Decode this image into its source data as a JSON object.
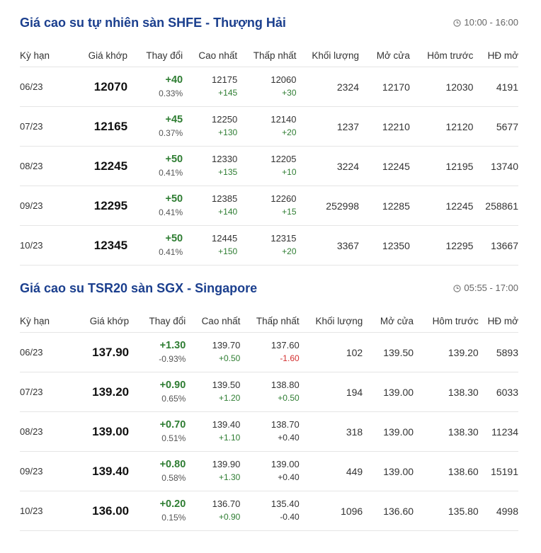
{
  "colors": {
    "title": "#1b3f8e",
    "positive": "#2e7d32",
    "negative": "#d32f2f",
    "border": "#e5e5e5"
  },
  "columns": [
    "Kỳ hạn",
    "Giá khớp",
    "Thay đổi",
    "Cao nhất",
    "Thấp nhất",
    "Khối lượng",
    "Mở cửa",
    "Hôm trước",
    "HĐ mở"
  ],
  "sections": [
    {
      "title": "Giá cao su tự nhiên sàn SHFE - Thượng Hải",
      "time_icon": "clock-icon",
      "time": "10:00 - 16:00",
      "rows": [
        {
          "term": "06/23",
          "price": "12070",
          "change": "+40",
          "change_pct": "0.33%",
          "high": "12175",
          "high_chg": "+145",
          "high_dir": "pos",
          "low": "12060",
          "low_chg": "+30",
          "low_dir": "pos",
          "volume": "2324",
          "open": "12170",
          "prev": "12030",
          "oi": "4191"
        },
        {
          "term": "07/23",
          "price": "12165",
          "change": "+45",
          "change_pct": "0.37%",
          "high": "12250",
          "high_chg": "+130",
          "high_dir": "pos",
          "low": "12140",
          "low_chg": "+20",
          "low_dir": "pos",
          "volume": "1237",
          "open": "12210",
          "prev": "12120",
          "oi": "5677"
        },
        {
          "term": "08/23",
          "price": "12245",
          "change": "+50",
          "change_pct": "0.41%",
          "high": "12330",
          "high_chg": "+135",
          "high_dir": "pos",
          "low": "12205",
          "low_chg": "+10",
          "low_dir": "pos",
          "volume": "3224",
          "open": "12245",
          "prev": "12195",
          "oi": "13740"
        },
        {
          "term": "09/23",
          "price": "12295",
          "change": "+50",
          "change_pct": "0.41%",
          "high": "12385",
          "high_chg": "+140",
          "high_dir": "pos",
          "low": "12260",
          "low_chg": "+15",
          "low_dir": "pos",
          "volume": "252998",
          "open": "12285",
          "prev": "12245",
          "oi": "258861"
        },
        {
          "term": "10/23",
          "price": "12345",
          "change": "+50",
          "change_pct": "0.41%",
          "high": "12445",
          "high_chg": "+150",
          "high_dir": "pos",
          "low": "12315",
          "low_chg": "+20",
          "low_dir": "pos",
          "volume": "3367",
          "open": "12350",
          "prev": "12295",
          "oi": "13667"
        }
      ]
    },
    {
      "title": "Giá cao su TSR20 sàn SGX - Singapore",
      "time_icon": "clock-icon",
      "time": "05:55 - 17:00",
      "rows": [
        {
          "term": "06/23",
          "price": "137.90",
          "change": "+1.30",
          "change_pct": "-0.93%",
          "high": "139.70",
          "high_chg": "+0.50",
          "high_dir": "pos",
          "low": "137.60",
          "low_chg": "-1.60",
          "low_dir": "neg",
          "volume": "102",
          "open": "139.50",
          "prev": "139.20",
          "oi": "5893"
        },
        {
          "term": "07/23",
          "price": "139.20",
          "change": "+0.90",
          "change_pct": "0.65%",
          "high": "139.50",
          "high_chg": "+1.20",
          "high_dir": "pos",
          "low": "138.80",
          "low_chg": "+0.50",
          "low_dir": "pos",
          "volume": "194",
          "open": "139.00",
          "prev": "138.30",
          "oi": "6033"
        },
        {
          "term": "08/23",
          "price": "139.00",
          "change": "+0.70",
          "change_pct": "0.51%",
          "high": "139.40",
          "high_chg": "+1.10",
          "high_dir": "pos",
          "low": "138.70",
          "low_chg": "+0.40",
          "low_dir": "neu",
          "volume": "318",
          "open": "139.00",
          "prev": "138.30",
          "oi": "11234"
        },
        {
          "term": "09/23",
          "price": "139.40",
          "change": "+0.80",
          "change_pct": "0.58%",
          "high": "139.90",
          "high_chg": "+1.30",
          "high_dir": "pos",
          "low": "139.00",
          "low_chg": "+0.40",
          "low_dir": "neu",
          "volume": "449",
          "open": "139.00",
          "prev": "138.60",
          "oi": "15191"
        },
        {
          "term": "10/23",
          "price": "136.00",
          "change": "+0.20",
          "change_pct": "0.15%",
          "high": "136.70",
          "high_chg": "+0.90",
          "high_dir": "pos",
          "low": "135.40",
          "low_chg": "-0.40",
          "low_dir": "neu",
          "volume": "1096",
          "open": "136.60",
          "prev": "135.80",
          "oi": "4998"
        }
      ]
    }
  ]
}
